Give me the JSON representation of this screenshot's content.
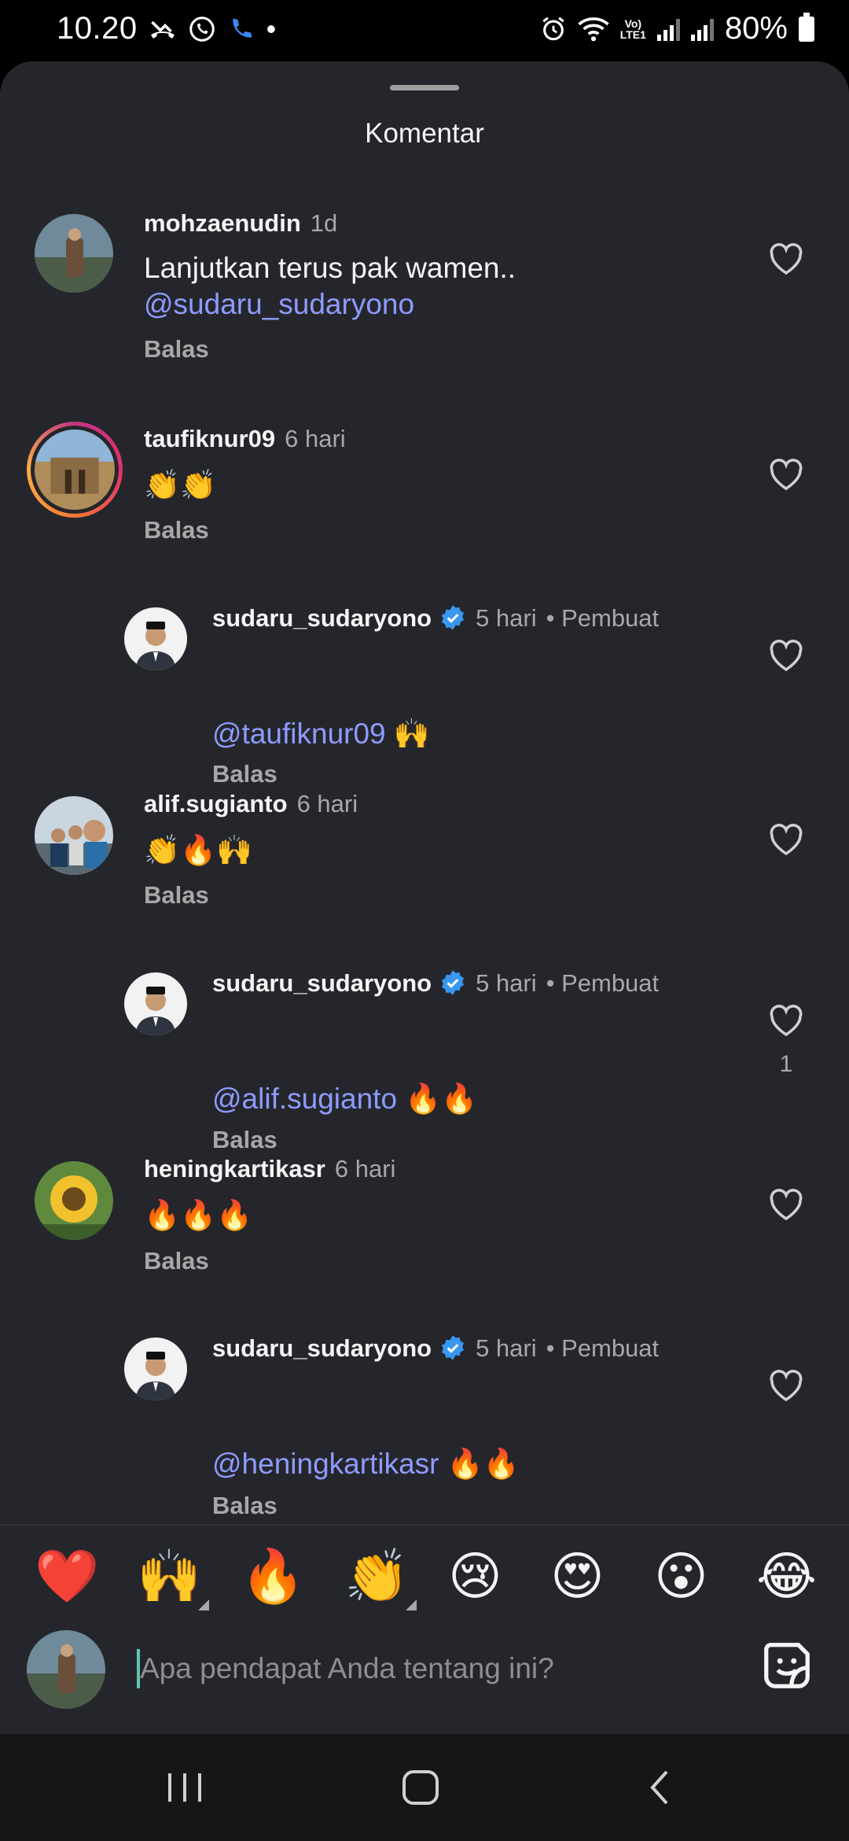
{
  "status_bar": {
    "time": "10.20",
    "battery": "80%",
    "lte_top": "Vo)",
    "lte_bottom": "LTE1"
  },
  "sheet": {
    "title": "Komentar"
  },
  "comments": [
    {
      "username": "mohzaenudin",
      "time": "1d",
      "text_line1": "Lanjutkan terus pak wamen..",
      "mention": "@sudaru_sudaryono",
      "reply_label": "Balas"
    },
    {
      "username": "taufiknur09",
      "time": "6 hari",
      "emoji": "👏👏",
      "reply_label": "Balas"
    },
    {
      "username": "sudaru_sudaryono",
      "time": "5 hari",
      "role": "• Pembuat",
      "mention": "@taufiknur09",
      "emoji": "🙌",
      "reply_label": "Balas"
    },
    {
      "username": "alif.sugianto",
      "time": "6 hari",
      "emoji": "👏🔥🙌",
      "reply_label": "Balas"
    },
    {
      "username": "sudaru_sudaryono",
      "time": "5 hari",
      "role": "• Pembuat",
      "mention": "@alif.sugianto",
      "emoji": "🔥🔥",
      "reply_label": "Balas",
      "likes": "1"
    },
    {
      "username": "heningkartikasr",
      "time": "6 hari",
      "emoji": "🔥🔥🔥",
      "reply_label": "Balas"
    },
    {
      "username": "sudaru_sudaryono",
      "time": "5 hari",
      "role": "• Pembuat",
      "mention": "@heningkartikasr",
      "emoji": "🔥🔥",
      "reply_label": "Balas"
    }
  ],
  "reactions": [
    "❤️",
    "🙌",
    "🔥",
    "👏",
    "😢",
    "😍",
    "😮",
    "😂"
  ],
  "input": {
    "placeholder": "Apa pendapat Anda tentang ini?"
  },
  "colors": {
    "sheet_bg": "#25262b",
    "mention": "#8e9bff",
    "verified": "#3897f0",
    "secondary_text": "#a8a8a8"
  }
}
